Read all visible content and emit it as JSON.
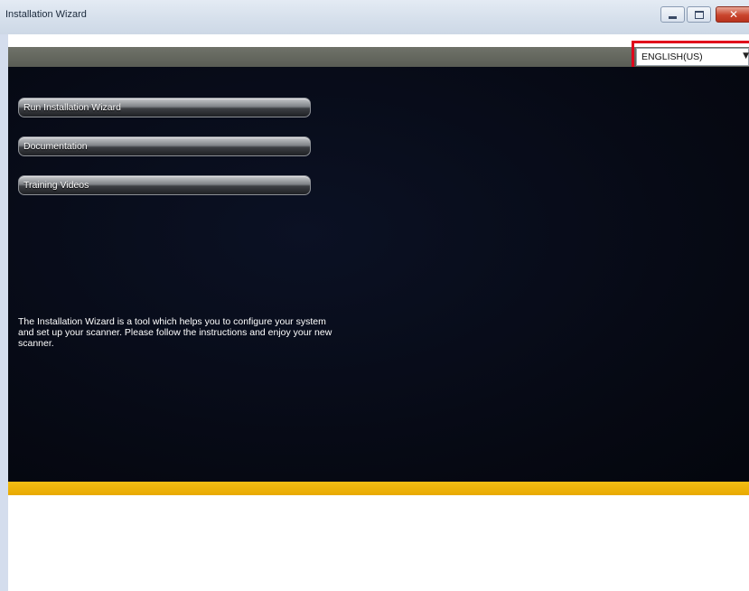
{
  "window": {
    "title": "Installation Wizard",
    "close_glyph": "✕"
  },
  "language": {
    "selected": "ENGLISH(US)",
    "arrow": "▼"
  },
  "nav": {
    "run_wizard": "Run Installation Wizard",
    "documentation": "Documentation",
    "training_videos": "Training Videos"
  },
  "description": "The Installation Wizard is a tool which helps you to configure your system and set up your scanner. Please follow the instructions and enjoy your new scanner.",
  "colors": {
    "panel_background": "#060913",
    "accent_strip": "#f0b400",
    "highlight_box": "#e0001b"
  },
  "icons": {
    "minimize": "minimize-icon",
    "maximize": "maximize-icon",
    "close": "close-icon",
    "dropdown": "chevron-down-icon"
  }
}
